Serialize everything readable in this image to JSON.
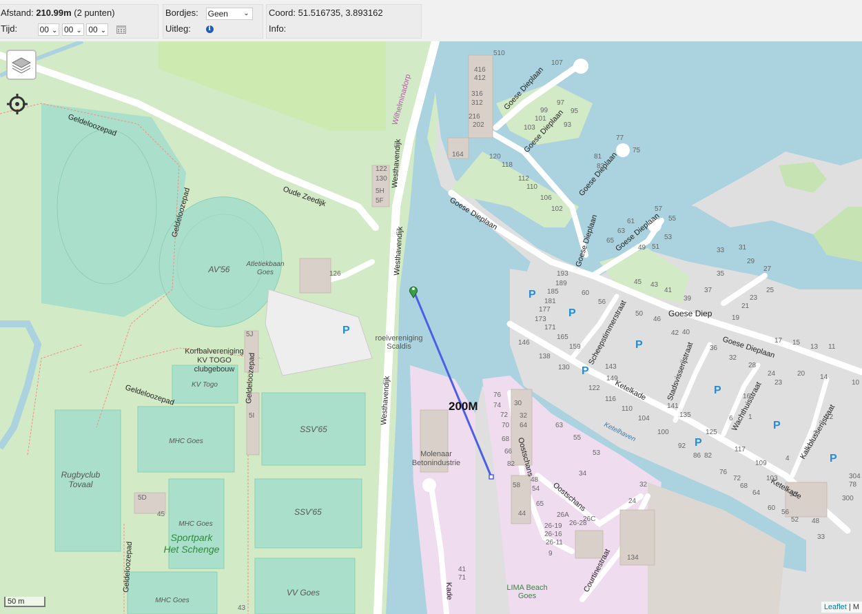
{
  "toolbar": {
    "distance": {
      "label": "Afstand:",
      "value": "210.99m",
      "points": "(2 punten)"
    },
    "time": {
      "label": "Tijd:",
      "hours": "00",
      "minutes": "00",
      "seconds": "00"
    },
    "signs": {
      "label": "Bordjes:",
      "value": "Geen"
    },
    "explanation": {
      "label": "Uitleg:"
    },
    "coord": {
      "label": "Coord:",
      "value": "51.516735, 3.893162"
    },
    "info": {
      "label": "Info:"
    }
  },
  "map": {
    "distance_label": "200M",
    "scale": "50 m",
    "attribution": "Leaflet",
    "attribution_sep": "|",
    "attribution_rest": "M",
    "route_color": "#4a5fe8",
    "labels": {
      "westhavendijk_top": "Westhavendijk",
      "westhavendijk_mid": "Westhavendijk",
      "westhavendijk_low": "Westhavendijk",
      "wilhelminadorp": "Wilhelminadorp",
      "oude_zeedijk": "Oude Zeedijk",
      "geldeloozepad_1": "Geldeloozepad",
      "geldeloozepad_2": "Geldeloozepad",
      "geldeloozepad_3": "Geldeloozepad",
      "geldeloozepad_4": "Geldeloozepad",
      "geldeloozepad_5": "Geldeloozepad",
      "av56": "AV'56",
      "atletiekbaan_1": "Atletiekbaan",
      "atletiekbaan_2": "Goes",
      "korfbal_1": "Korfbalvereniging",
      "korfbal_2": "KV TOGO",
      "korfbal_3": "clubgebouw",
      "kv_togo": "KV Togo",
      "mhc_1": "MHC Goes",
      "mhc_2": "MHC Goes",
      "mhc_3": "MHC Goes",
      "ssv_1": "SSV'65",
      "ssv_2": "SSV'65",
      "vv_goes": "VV Goes",
      "rugby_1": "Rugbyclub",
      "rugby_2": "Tovaal",
      "sportpark_1": "Sportpark",
      "sportpark_2": "Het Schenge",
      "roeivereniging_1": "roeivereniging",
      "roeivereniging_2": "Scaldis",
      "molenaar_1": "Molenaar",
      "molenaar_2": "Betonindustrie",
      "goese_dieplaan_1": "Goese Dieplaan",
      "goese_dieplaan_2": "Goese Dieplaan",
      "goese_dieplaan_3": "Goese Dieplaan",
      "goese_dieplaan_4": "Goese Dieplaan",
      "goese_dieplaan_5": "Goese Dieplaan",
      "goese_dieplaan_6": "Goese Dieplaan",
      "goese_dieplaan_7": "Goese Dieplaan",
      "goese_diep": "Goese Diep",
      "scheepstimmer": "Scheepstimmerstraat",
      "stadsvisser": "Stadsvisserijstraat",
      "wachthuis": "Wachthuisstraat",
      "kalkblusser": "Kalkblusserijstraat",
      "ketelkade_1": "Ketelkade",
      "ketelkade_2": "Ketelkade",
      "ketelhaven": "Ketelhaven",
      "oostschans_1": "Oostschans",
      "oostschans_2": "Oostschans",
      "courtinestraat": "Courtinestraat",
      "lima_1": "LIMA Beach",
      "lima_2": "Goes",
      "havenkade": "Kade",
      "parking": "P"
    },
    "house_numbers": [
      "510",
      "107",
      "416",
      "412",
      "316",
      "312",
      "216",
      "202",
      "164",
      "99",
      "97",
      "95",
      "101",
      "93",
      "103",
      "120",
      "118",
      "112",
      "110",
      "106",
      "102",
      "77",
      "75",
      "81",
      "83",
      "57",
      "55",
      "61",
      "63",
      "53",
      "65",
      "49",
      "51",
      "33",
      "31",
      "29",
      "27",
      "25",
      "23",
      "21",
      "19",
      "35",
      "37",
      "39",
      "41",
      "43",
      "45",
      "193",
      "189",
      "185",
      "181",
      "177",
      "173",
      "171",
      "165",
      "159",
      "60",
      "56",
      "50",
      "46",
      "42",
      "40",
      "36",
      "32",
      "28",
      "24",
      "20",
      "14",
      "17",
      "15",
      "13",
      "11",
      "146",
      "138",
      "130",
      "122",
      "116",
      "110",
      "104",
      "100",
      "92",
      "86",
      "82",
      "76",
      "72",
      "68",
      "64",
      "60",
      "56",
      "52",
      "48",
      "143",
      "149",
      "141",
      "135",
      "125",
      "117",
      "109",
      "103",
      "10",
      "22",
      "23",
      "16",
      "6",
      "4",
      "1",
      "2",
      "33",
      "53",
      "300",
      "304",
      "78",
      "76",
      "74",
      "72",
      "70",
      "68",
      "66",
      "82",
      "30",
      "32",
      "64",
      "58",
      "44",
      "48",
      "54",
      "65",
      "63",
      "55",
      "53",
      "34",
      "32",
      "24",
      "26C",
      "26A",
      "26-28",
      "26-19",
      "26-16",
      "26-11",
      "9",
      "134",
      "126",
      "122",
      "130",
      "5H",
      "5F",
      "5J",
      "5I",
      "5D",
      "45",
      "43",
      "41",
      "71"
    ]
  }
}
